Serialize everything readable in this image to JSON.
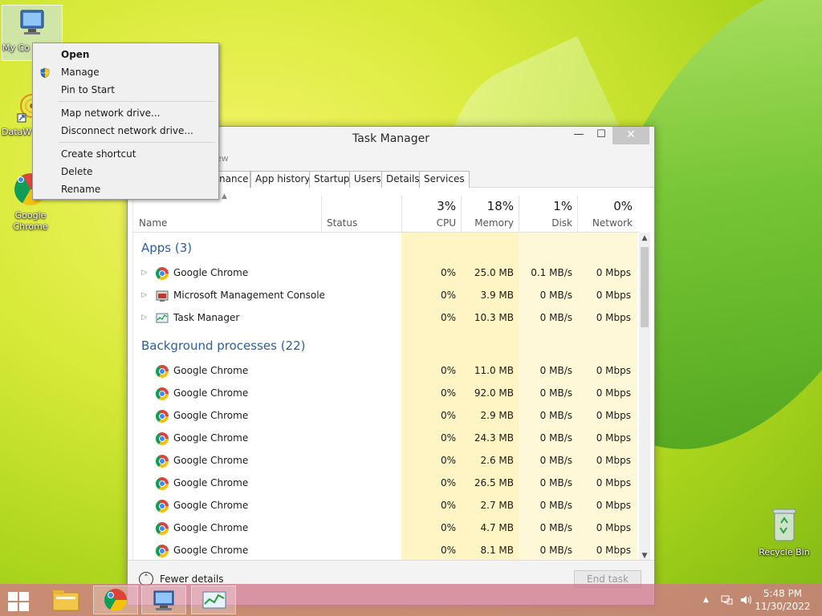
{
  "desktop": {
    "icons": [
      {
        "label": "My Co"
      },
      {
        "label": "DataW"
      },
      {
        "label": "Google Chrome"
      },
      {
        "label": "Recycle Bin"
      }
    ]
  },
  "context_menu": {
    "items": [
      "Open",
      "Manage",
      "Pin to Start",
      "Map network drive...",
      "Disconnect network drive...",
      "Create shortcut",
      "Delete",
      "Rename"
    ]
  },
  "task_manager": {
    "title": "Task Manager",
    "menu_fragment": "ew",
    "window_buttons": {
      "minimize": "—",
      "maximize": "☐",
      "close": "✕"
    },
    "tabs": [
      "nance",
      "App history",
      "Startup",
      "Users",
      "Details",
      "Services"
    ],
    "columns": {
      "name": "Name",
      "status": "Status",
      "cpu": {
        "pct": "3%",
        "label": "CPU"
      },
      "memory": {
        "pct": "18%",
        "label": "Memory"
      },
      "disk": {
        "pct": "1%",
        "label": "Disk"
      },
      "network": {
        "pct": "0%",
        "label": "Network"
      }
    },
    "groups": {
      "apps": "Apps (3)",
      "background": "Background processes (22)"
    },
    "apps": [
      {
        "name": "Google Chrome",
        "icon": "chrome-icon",
        "cpu": "0%",
        "memory": "25.0 MB",
        "disk": "0.1 MB/s",
        "network": "0 Mbps"
      },
      {
        "name": "Microsoft Management Console",
        "icon": "mmc-icon",
        "cpu": "0%",
        "memory": "3.9 MB",
        "disk": "0 MB/s",
        "network": "0 Mbps"
      },
      {
        "name": "Task Manager",
        "icon": "task-manager-icon",
        "cpu": "0%",
        "memory": "10.3 MB",
        "disk": "0 MB/s",
        "network": "0 Mbps"
      }
    ],
    "background": [
      {
        "name": "Google Chrome",
        "cpu": "0%",
        "memory": "11.0 MB",
        "disk": "0 MB/s",
        "network": "0 Mbps"
      },
      {
        "name": "Google Chrome",
        "cpu": "0%",
        "memory": "92.0 MB",
        "disk": "0 MB/s",
        "network": "0 Mbps"
      },
      {
        "name": "Google Chrome",
        "cpu": "0%",
        "memory": "2.9 MB",
        "disk": "0 MB/s",
        "network": "0 Mbps"
      },
      {
        "name": "Google Chrome",
        "cpu": "0%",
        "memory": "24.3 MB",
        "disk": "0 MB/s",
        "network": "0 Mbps"
      },
      {
        "name": "Google Chrome",
        "cpu": "0%",
        "memory": "2.6 MB",
        "disk": "0 MB/s",
        "network": "0 Mbps"
      },
      {
        "name": "Google Chrome",
        "cpu": "0%",
        "memory": "26.5 MB",
        "disk": "0 MB/s",
        "network": "0 Mbps"
      },
      {
        "name": "Google Chrome",
        "cpu": "0%",
        "memory": "2.7 MB",
        "disk": "0 MB/s",
        "network": "0 Mbps"
      },
      {
        "name": "Google Chrome",
        "cpu": "0%",
        "memory": "4.7 MB",
        "disk": "0 MB/s",
        "network": "0 Mbps"
      },
      {
        "name": "Google Chrome",
        "cpu": "0%",
        "memory": "8.1 MB",
        "disk": "0 MB/s",
        "network": "0 Mbps"
      }
    ],
    "footer": {
      "fewer_details": "Fewer details",
      "end_task": "End task"
    }
  },
  "taskbar": {
    "time": "5:48 PM",
    "date": "11/30/2022",
    "apps": [
      "file-explorer-icon",
      "chrome-icon",
      "computer-management-icon",
      "task-manager-icon"
    ]
  },
  "colors": {
    "group_title": "#2a5ea8",
    "heat_cell": "#fff4c4",
    "taskbar": "#d1788c"
  }
}
